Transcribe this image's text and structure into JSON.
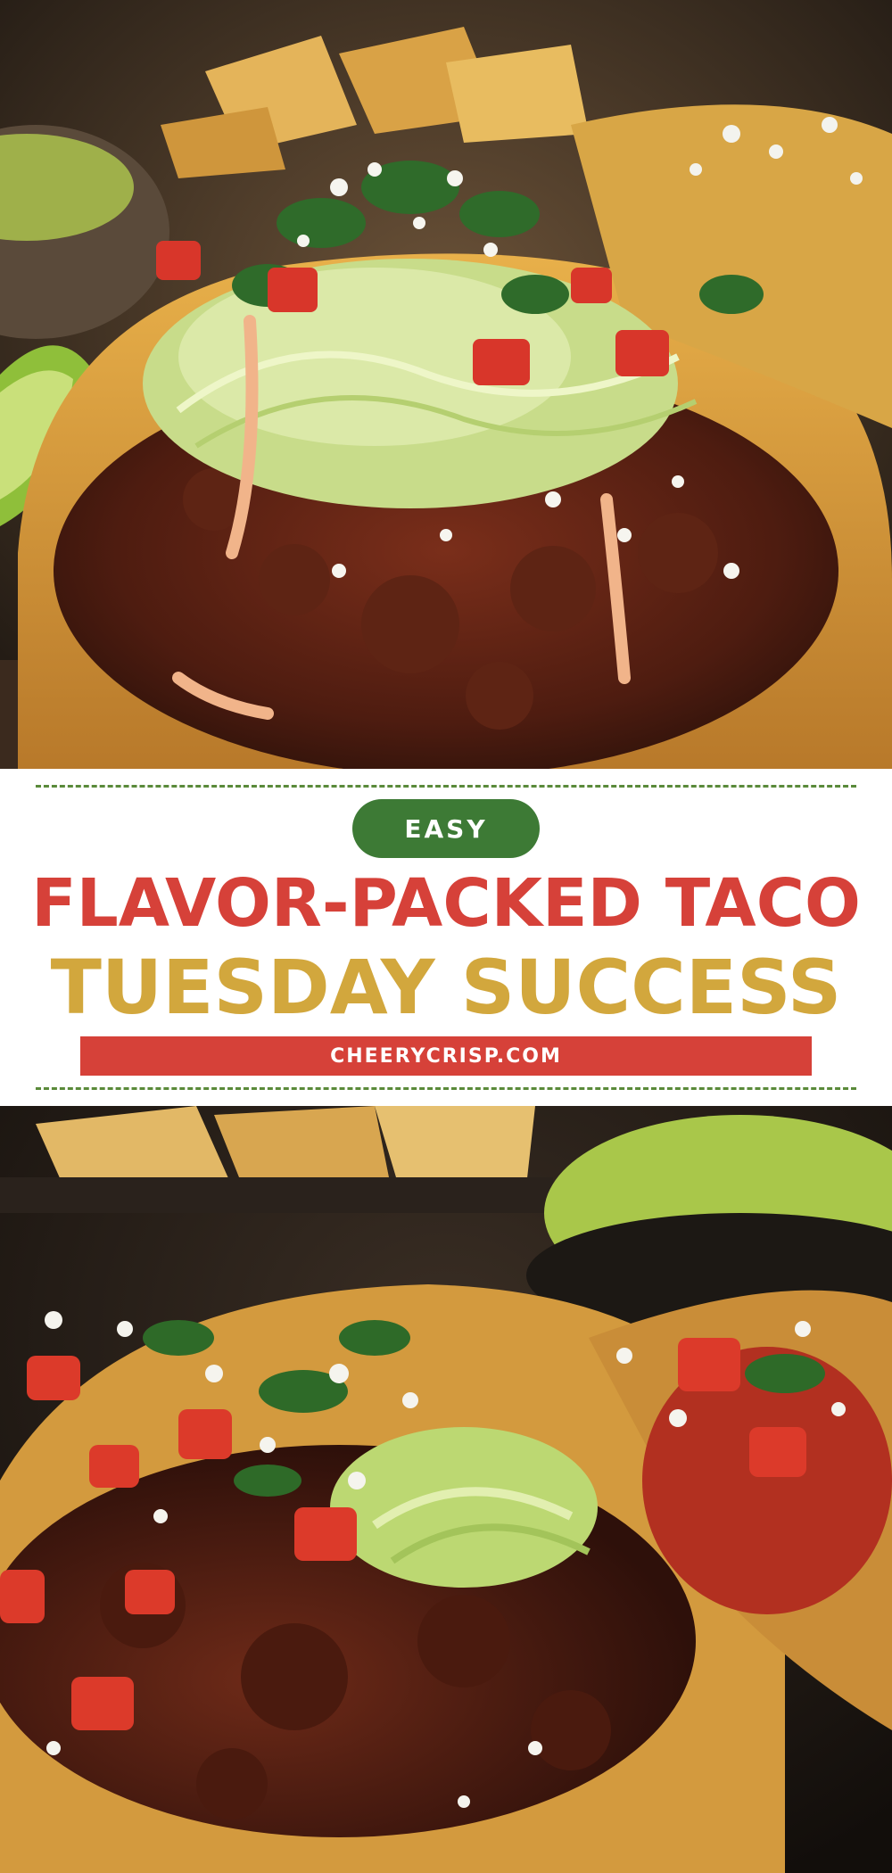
{
  "header_photo": {
    "subject": "taco-photo"
  },
  "banner": {
    "badge": "EASY",
    "title_line_1": "FLAVOR-PACKED TACO",
    "title_line_2": "TUESDAY SUCCESS",
    "website": "CHEERYCRISP.COM"
  },
  "colors": {
    "badge_green": "#3d7a35",
    "title_red": "#d64139",
    "title_gold": "#d2a73d",
    "divider_green": "#5a8a3a"
  },
  "footer_photo": {
    "subject": "taco-photo"
  }
}
